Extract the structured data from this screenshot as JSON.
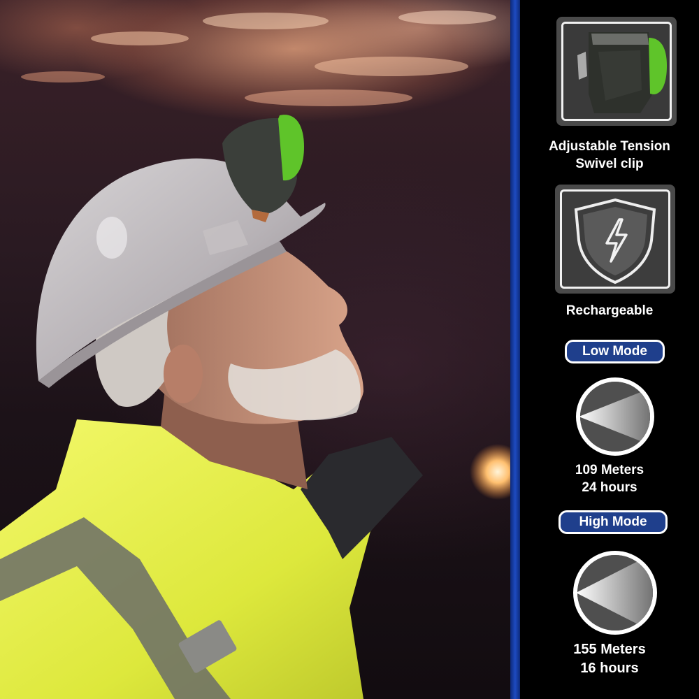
{
  "features": {
    "swivel_clip": {
      "line1": "Adjustable Tension",
      "line2": "Swivel clip",
      "icon": "headlamp-clip-icon"
    },
    "rechargeable": {
      "label": "Rechargeable",
      "icon": "shield-lightning-icon"
    }
  },
  "modes": {
    "low": {
      "label": "Low Mode",
      "distance": "109 Meters",
      "runtime": "24 hours",
      "icon": "narrow-beam-icon"
    },
    "high": {
      "label": "High Mode",
      "distance": "155 Meters",
      "runtime": "16 hours",
      "icon": "wide-beam-icon"
    }
  },
  "colors": {
    "divider": "#1e4bc0",
    "pill": "#1f3f8c",
    "headlamp_accent": "#5fc42a",
    "vest": "#e8f04a"
  }
}
